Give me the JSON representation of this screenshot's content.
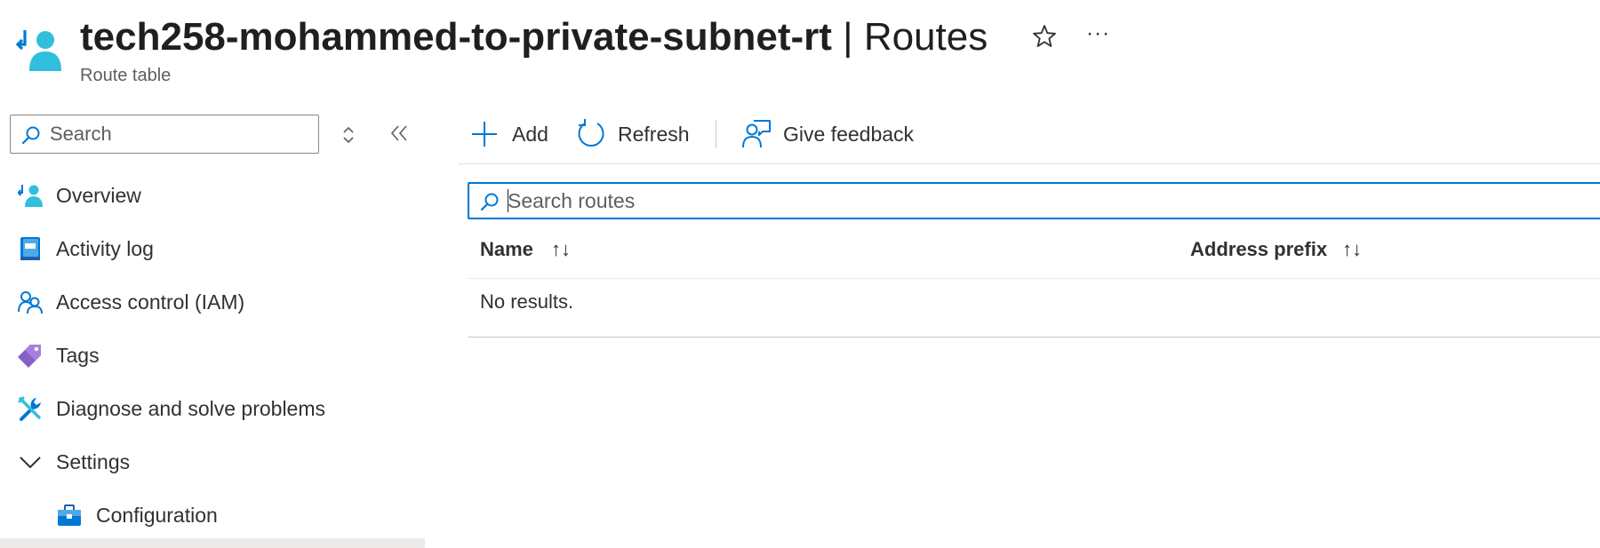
{
  "header": {
    "resource_name": "tech258-mohammed-to-private-subnet-rt",
    "separator": "|",
    "blade_title": "Routes",
    "resource_type": "Route table",
    "more_label": "···"
  },
  "menu": {
    "search_placeholder": "Search",
    "items": [
      {
        "label": "Overview",
        "icon": "route-table-icon"
      },
      {
        "label": "Activity log",
        "icon": "activity-log-icon"
      },
      {
        "label": "Access control (IAM)",
        "icon": "iam-icon"
      },
      {
        "label": "Tags",
        "icon": "tag-icon"
      },
      {
        "label": "Diagnose and solve problems",
        "icon": "wrench-icon"
      },
      {
        "label": "Settings",
        "icon": "chevron-down-icon",
        "expanded": true
      },
      {
        "label": "Configuration",
        "icon": "toolbox-icon",
        "indent": true
      }
    ]
  },
  "toolbar": {
    "add_label": "Add",
    "refresh_label": "Refresh",
    "feedback_label": "Give feedback"
  },
  "routes": {
    "search_placeholder": "Search routes",
    "columns": [
      "Name",
      "Address prefix"
    ],
    "sort_glyph": "↑↓",
    "empty_text": "No results."
  },
  "colors": {
    "accent": "#0078d4",
    "icon_teal": "#32bedd",
    "tag_purple": "#8661c5"
  }
}
